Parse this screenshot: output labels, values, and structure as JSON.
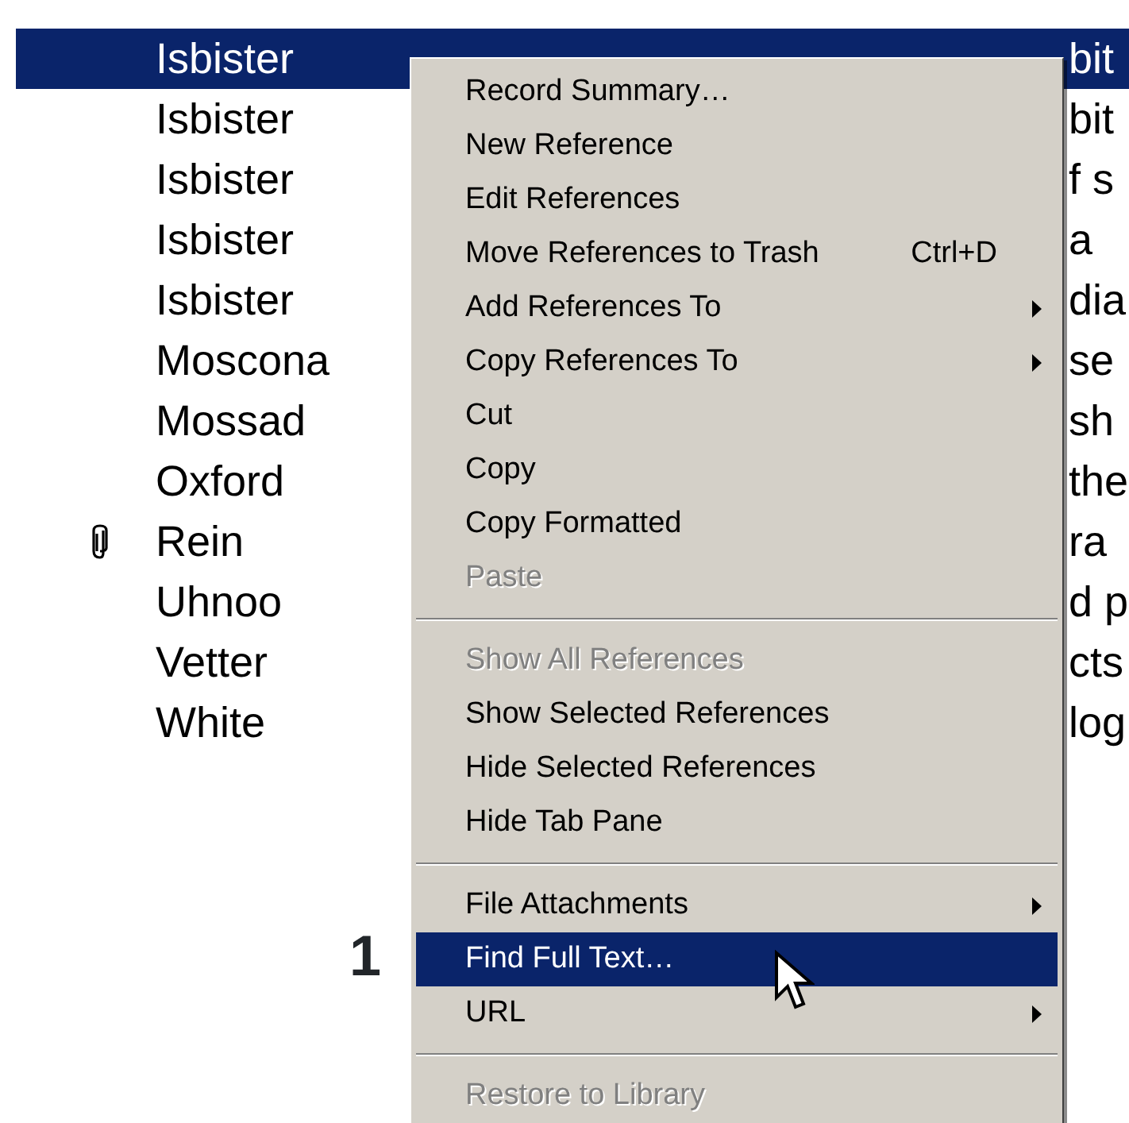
{
  "list": {
    "rows": [
      {
        "author": "Isbister",
        "title_fragment": "bit",
        "selected": true,
        "attachment": false
      },
      {
        "author": "Isbister",
        "title_fragment": "bit",
        "selected": false,
        "attachment": false
      },
      {
        "author": "Isbister",
        "title_fragment": "f s",
        "selected": false,
        "attachment": false
      },
      {
        "author": "Isbister",
        "title_fragment": "a",
        "selected": false,
        "attachment": false
      },
      {
        "author": "Isbister",
        "title_fragment": "dia",
        "selected": false,
        "attachment": false
      },
      {
        "author": "Moscona",
        "title_fragment": "se",
        "selected": false,
        "attachment": false
      },
      {
        "author": "Mossad",
        "title_fragment": "sh",
        "selected": false,
        "attachment": false
      },
      {
        "author": "Oxford",
        "title_fragment": "the",
        "selected": false,
        "attachment": false
      },
      {
        "author": "Rein",
        "title_fragment": "ra",
        "selected": false,
        "attachment": true
      },
      {
        "author": "Uhnoo",
        "title_fragment": "d p",
        "selected": false,
        "attachment": false
      },
      {
        "author": "Vetter",
        "title_fragment": "cts",
        "selected": false,
        "attachment": false
      },
      {
        "author": "White",
        "title_fragment": "log",
        "selected": false,
        "attachment": false
      }
    ]
  },
  "context_menu": {
    "items": [
      {
        "kind": "item",
        "label": "Record Summary…",
        "disabled": false,
        "selected": false
      },
      {
        "kind": "item",
        "label": "New Reference",
        "disabled": false,
        "selected": false
      },
      {
        "kind": "item",
        "label": "Edit References",
        "disabled": false,
        "selected": false
      },
      {
        "kind": "item",
        "label": "Move References to Trash",
        "shortcut": "Ctrl+D",
        "disabled": false,
        "selected": false
      },
      {
        "kind": "submenu",
        "label": "Add References To",
        "disabled": false,
        "selected": false
      },
      {
        "kind": "submenu",
        "label": "Copy References To",
        "disabled": false,
        "selected": false
      },
      {
        "kind": "item",
        "label": "Cut",
        "disabled": false,
        "selected": false
      },
      {
        "kind": "item",
        "label": "Copy",
        "disabled": false,
        "selected": false
      },
      {
        "kind": "item",
        "label": "Copy Formatted",
        "disabled": false,
        "selected": false
      },
      {
        "kind": "item",
        "label": "Paste",
        "disabled": true,
        "selected": false
      },
      {
        "kind": "separator"
      },
      {
        "kind": "item",
        "label": "Show All References",
        "disabled": true,
        "selected": false
      },
      {
        "kind": "item",
        "label": "Show Selected References",
        "disabled": false,
        "selected": false
      },
      {
        "kind": "item",
        "label": "Hide Selected References",
        "disabled": false,
        "selected": false
      },
      {
        "kind": "item",
        "label": "Hide Tab Pane",
        "disabled": false,
        "selected": false
      },
      {
        "kind": "separator"
      },
      {
        "kind": "submenu",
        "label": "File Attachments",
        "disabled": false,
        "selected": false
      },
      {
        "kind": "item",
        "label": "Find Full Text…",
        "disabled": false,
        "selected": true
      },
      {
        "kind": "submenu",
        "label": "URL",
        "disabled": false,
        "selected": false
      },
      {
        "kind": "separator"
      },
      {
        "kind": "item",
        "label": "Restore to Library",
        "disabled": true,
        "selected": false
      }
    ]
  },
  "step_number": "1"
}
